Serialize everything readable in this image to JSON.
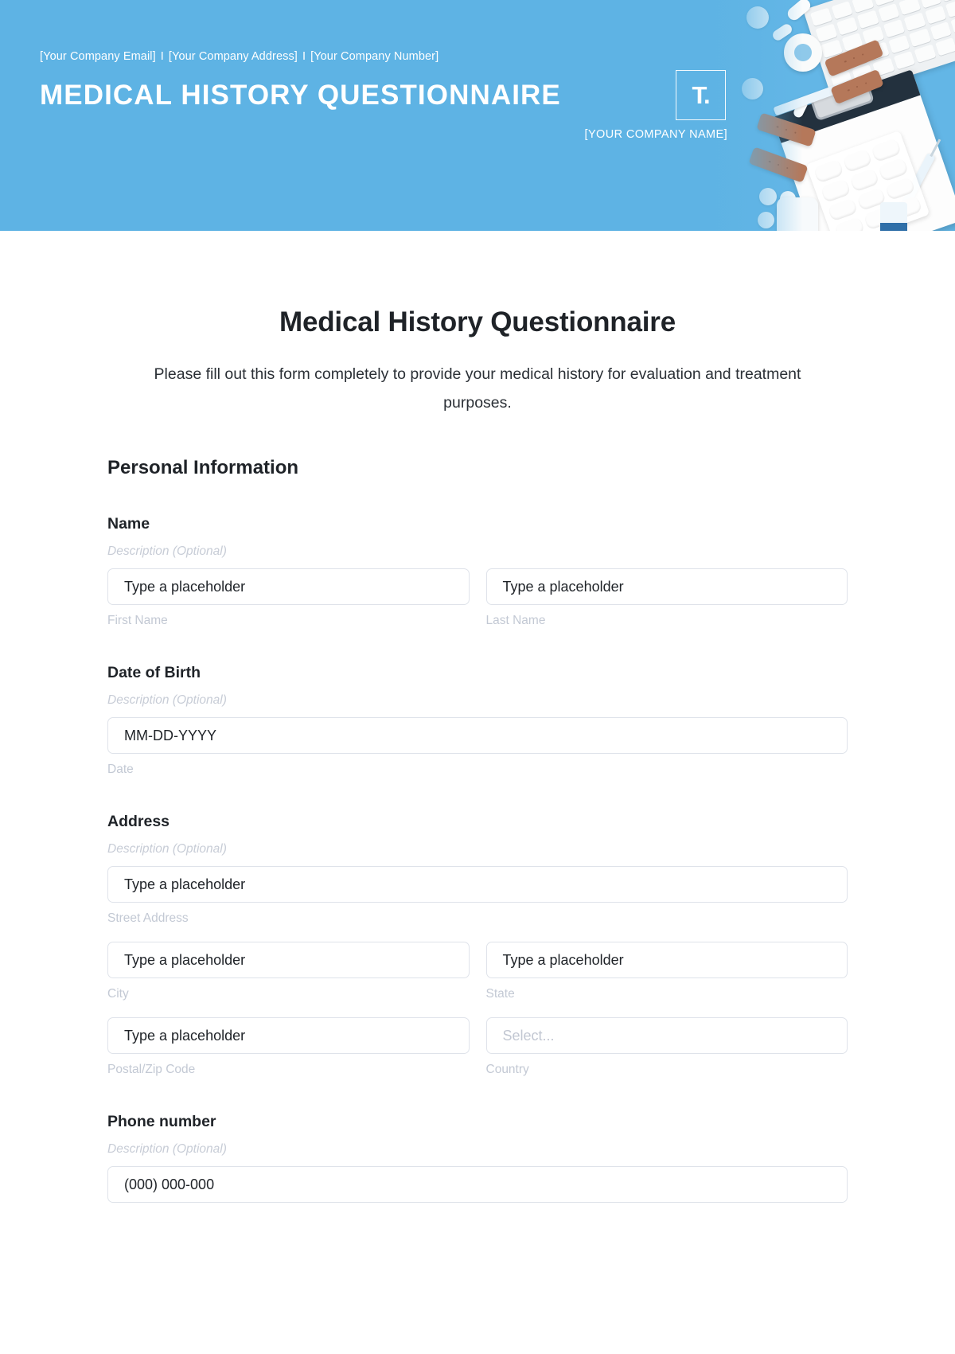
{
  "banner": {
    "contact": {
      "email": "[Your Company Email]",
      "address": "[Your Company Address]",
      "number": "[Your Company Number]",
      "separator": "I"
    },
    "title": "MEDICAL HISTORY QUESTIONNAIRE",
    "logo_mark": "T.",
    "company_name": "[YOUR COMPANY NAME]",
    "background_color": "#5eb3e4"
  },
  "form": {
    "title": "Medical History Questionnaire",
    "subtitle": "Please fill out this form completely to provide your medical history for evaluation and treatment purposes.",
    "section_title": "Personal Information",
    "description_placeholder": "Description (Optional)",
    "fields": {
      "name": {
        "label": "Name",
        "description": "Description (Optional)",
        "first": {
          "value": "Type a placeholder",
          "sub_label": "First Name"
        },
        "last": {
          "value": "Type a placeholder",
          "sub_label": "Last Name"
        }
      },
      "dob": {
        "label": "Date of Birth",
        "description": "Description (Optional)",
        "date": {
          "value": "MM-DD-YYYY",
          "sub_label": "Date"
        }
      },
      "address": {
        "label": "Address",
        "description": "Description (Optional)",
        "street": {
          "value": "Type a placeholder",
          "sub_label": "Street Address"
        },
        "city": {
          "value": "Type a placeholder",
          "sub_label": "City"
        },
        "state": {
          "value": "Type a placeholder",
          "sub_label": "State"
        },
        "postal": {
          "value": "Type a placeholder",
          "sub_label": "Postal/Zip Code"
        },
        "country": {
          "value": "Select...",
          "sub_label": "Country"
        }
      },
      "phone": {
        "label": "Phone number",
        "description": "Description (Optional)",
        "number": {
          "value": "(000) 000-000"
        }
      }
    }
  }
}
